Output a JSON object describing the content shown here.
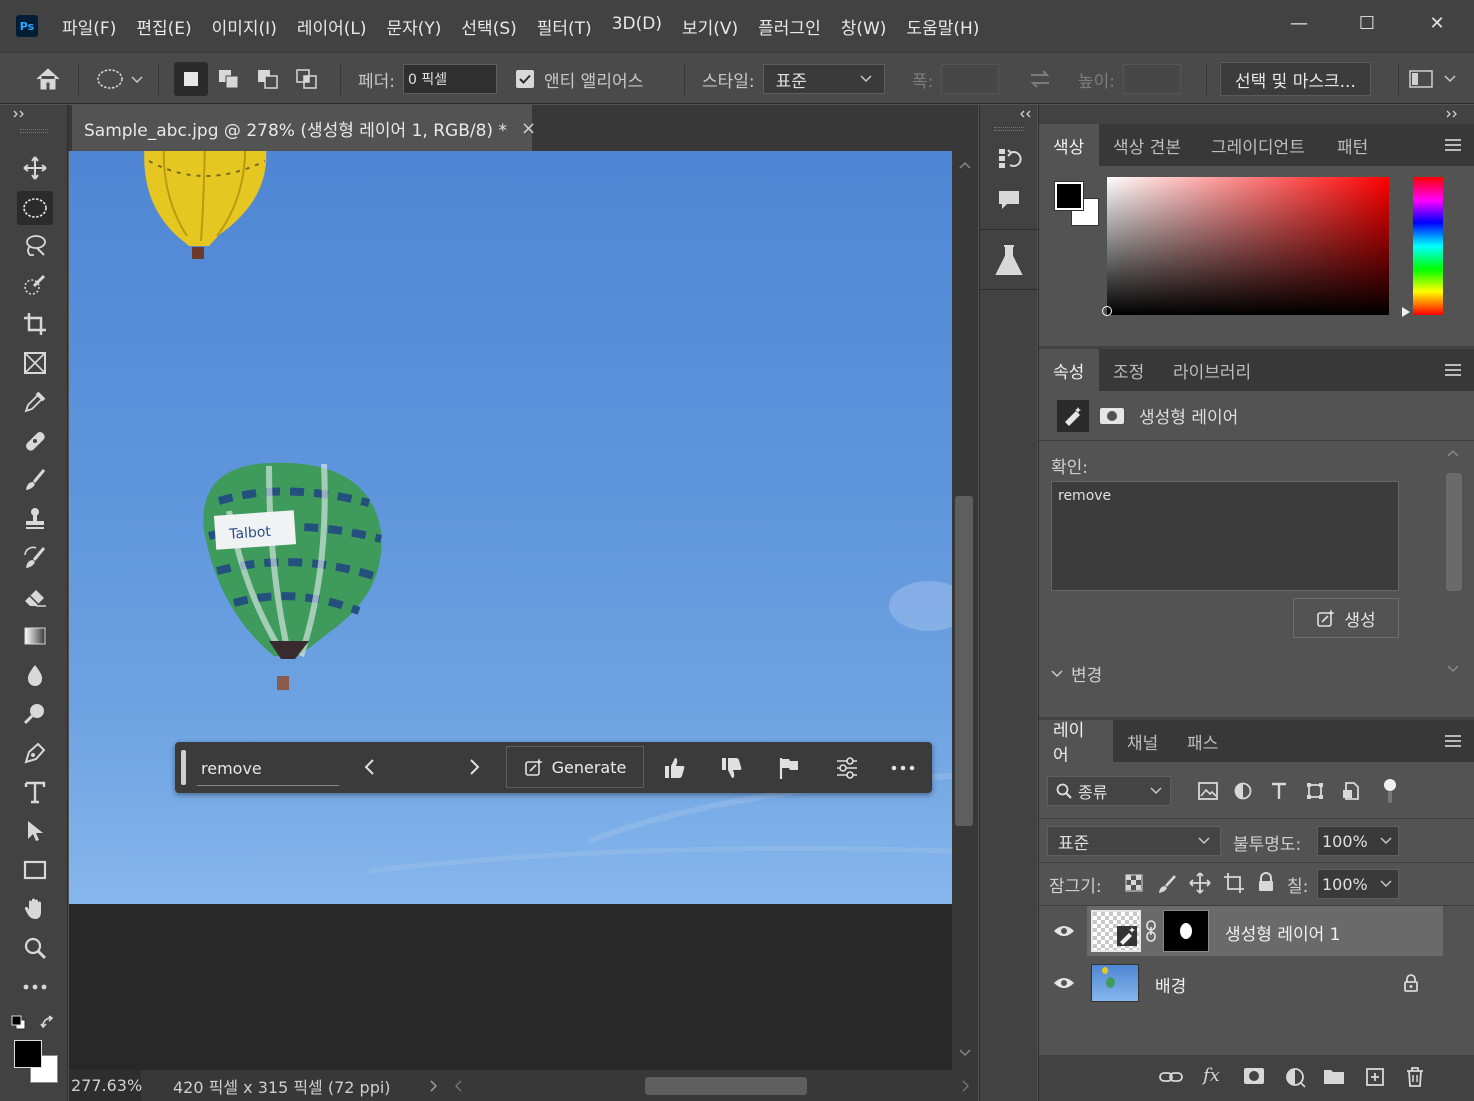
{
  "app": {
    "logo": "Ps"
  },
  "menu": [
    "파일(F)",
    "편집(E)",
    "이미지(I)",
    "레이어(L)",
    "문자(Y)",
    "선택(S)",
    "필터(T)",
    "3D(D)",
    "보기(V)",
    "플러그인",
    "창(W)",
    "도움말(H)"
  ],
  "window_controls": {
    "minimize": "—",
    "maximize": "☐",
    "close": "✕"
  },
  "options": {
    "feather_label": "페더:",
    "feather_value": "0 픽셀",
    "antialias_label": "앤티 앨리어스",
    "style_label": "스타일:",
    "style_value": "표준",
    "width_label": "폭:",
    "height_label": "높이:",
    "select_mask_button": "선택 및 마스크..."
  },
  "document": {
    "tab_title": "Sample_abc.jpg @ 278% (생성형 레이어 1, RGB/8) *",
    "tab_close": "×"
  },
  "status": {
    "zoom": "277.63%",
    "info": "420 픽셀 x 315 픽셀 (72 ppi)"
  },
  "taskbar": {
    "prompt": "remove",
    "generate_label": "Generate"
  },
  "color_panel": {
    "tabs": [
      "색상",
      "색상 견본",
      "그레이디언트",
      "패턴"
    ],
    "foreground": "#000000",
    "background": "#ffffff",
    "hue": "#ff0000"
  },
  "properties_panel": {
    "tabs": [
      "속성",
      "조정",
      "라이브러리"
    ],
    "layer_type": "생성형 레이어",
    "prompt_label": "확인:",
    "prompt_value": "remove",
    "generate_button": "생성",
    "variations_label": "변경"
  },
  "layers_panel": {
    "tabs": [
      "레이어",
      "채널",
      "패스"
    ],
    "filter_label": "종류",
    "blend_mode": "표준",
    "opacity_label": "불투명도:",
    "opacity_value": "100%",
    "lock_label": "잠그기:",
    "fill_label": "칠:",
    "fill_value": "100%",
    "layers": [
      {
        "name": "생성형 레이어 1"
      },
      {
        "name": "배경"
      }
    ]
  }
}
